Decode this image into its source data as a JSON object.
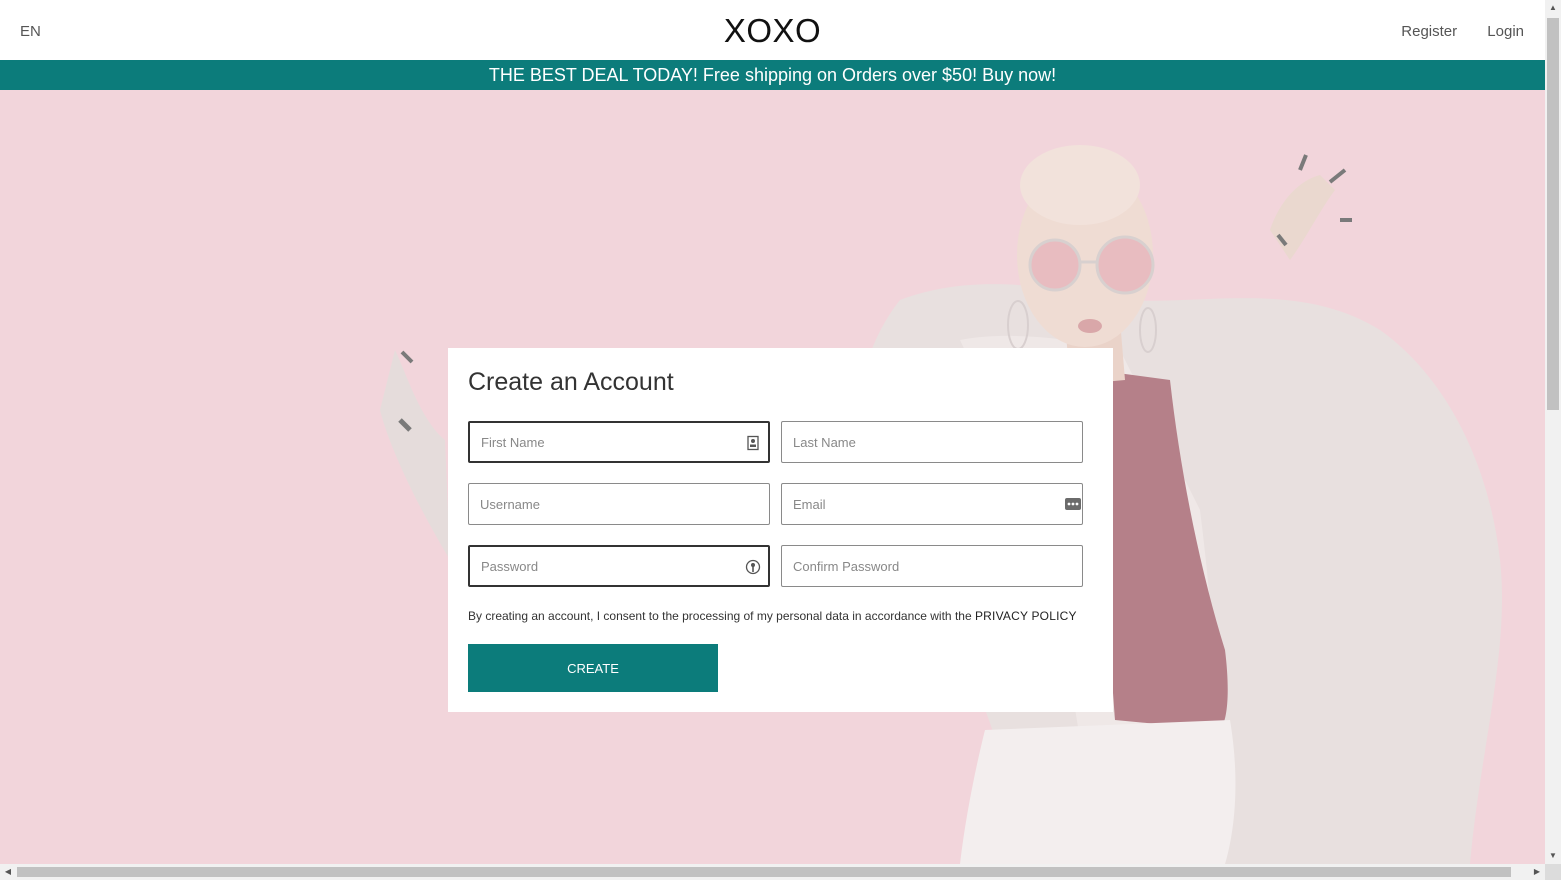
{
  "header": {
    "language": "EN",
    "logo": "XOXO",
    "nav": {
      "register": "Register",
      "login": "Login"
    }
  },
  "promo": {
    "text": "THE BEST DEAL TODAY! Free shipping on Orders over $50! Buy now!"
  },
  "form": {
    "title": "Create an Account",
    "fields": {
      "first_name": {
        "placeholder": "First Name",
        "value": ""
      },
      "last_name": {
        "placeholder": "Last Name",
        "value": ""
      },
      "username": {
        "placeholder": "Username",
        "value": ""
      },
      "email": {
        "placeholder": "Email",
        "value": ""
      },
      "password": {
        "placeholder": "Password",
        "value": ""
      },
      "confirm_password": {
        "placeholder": "Confirm Password",
        "value": ""
      }
    },
    "consent_text": "By creating an account, I consent to the processing of my personal data in accordance with the",
    "privacy_link": "PRIVACY POLICY",
    "submit_label": "CREATE"
  },
  "hero": {
    "background_color": "#f2d5db",
    "icon": "fashion-model-image"
  },
  "theme": {
    "accent": "#0c7c7b"
  },
  "icons": {
    "contact_card": "contact-card-icon",
    "password_manager": "password-dots-icon",
    "key": "key-icon"
  }
}
